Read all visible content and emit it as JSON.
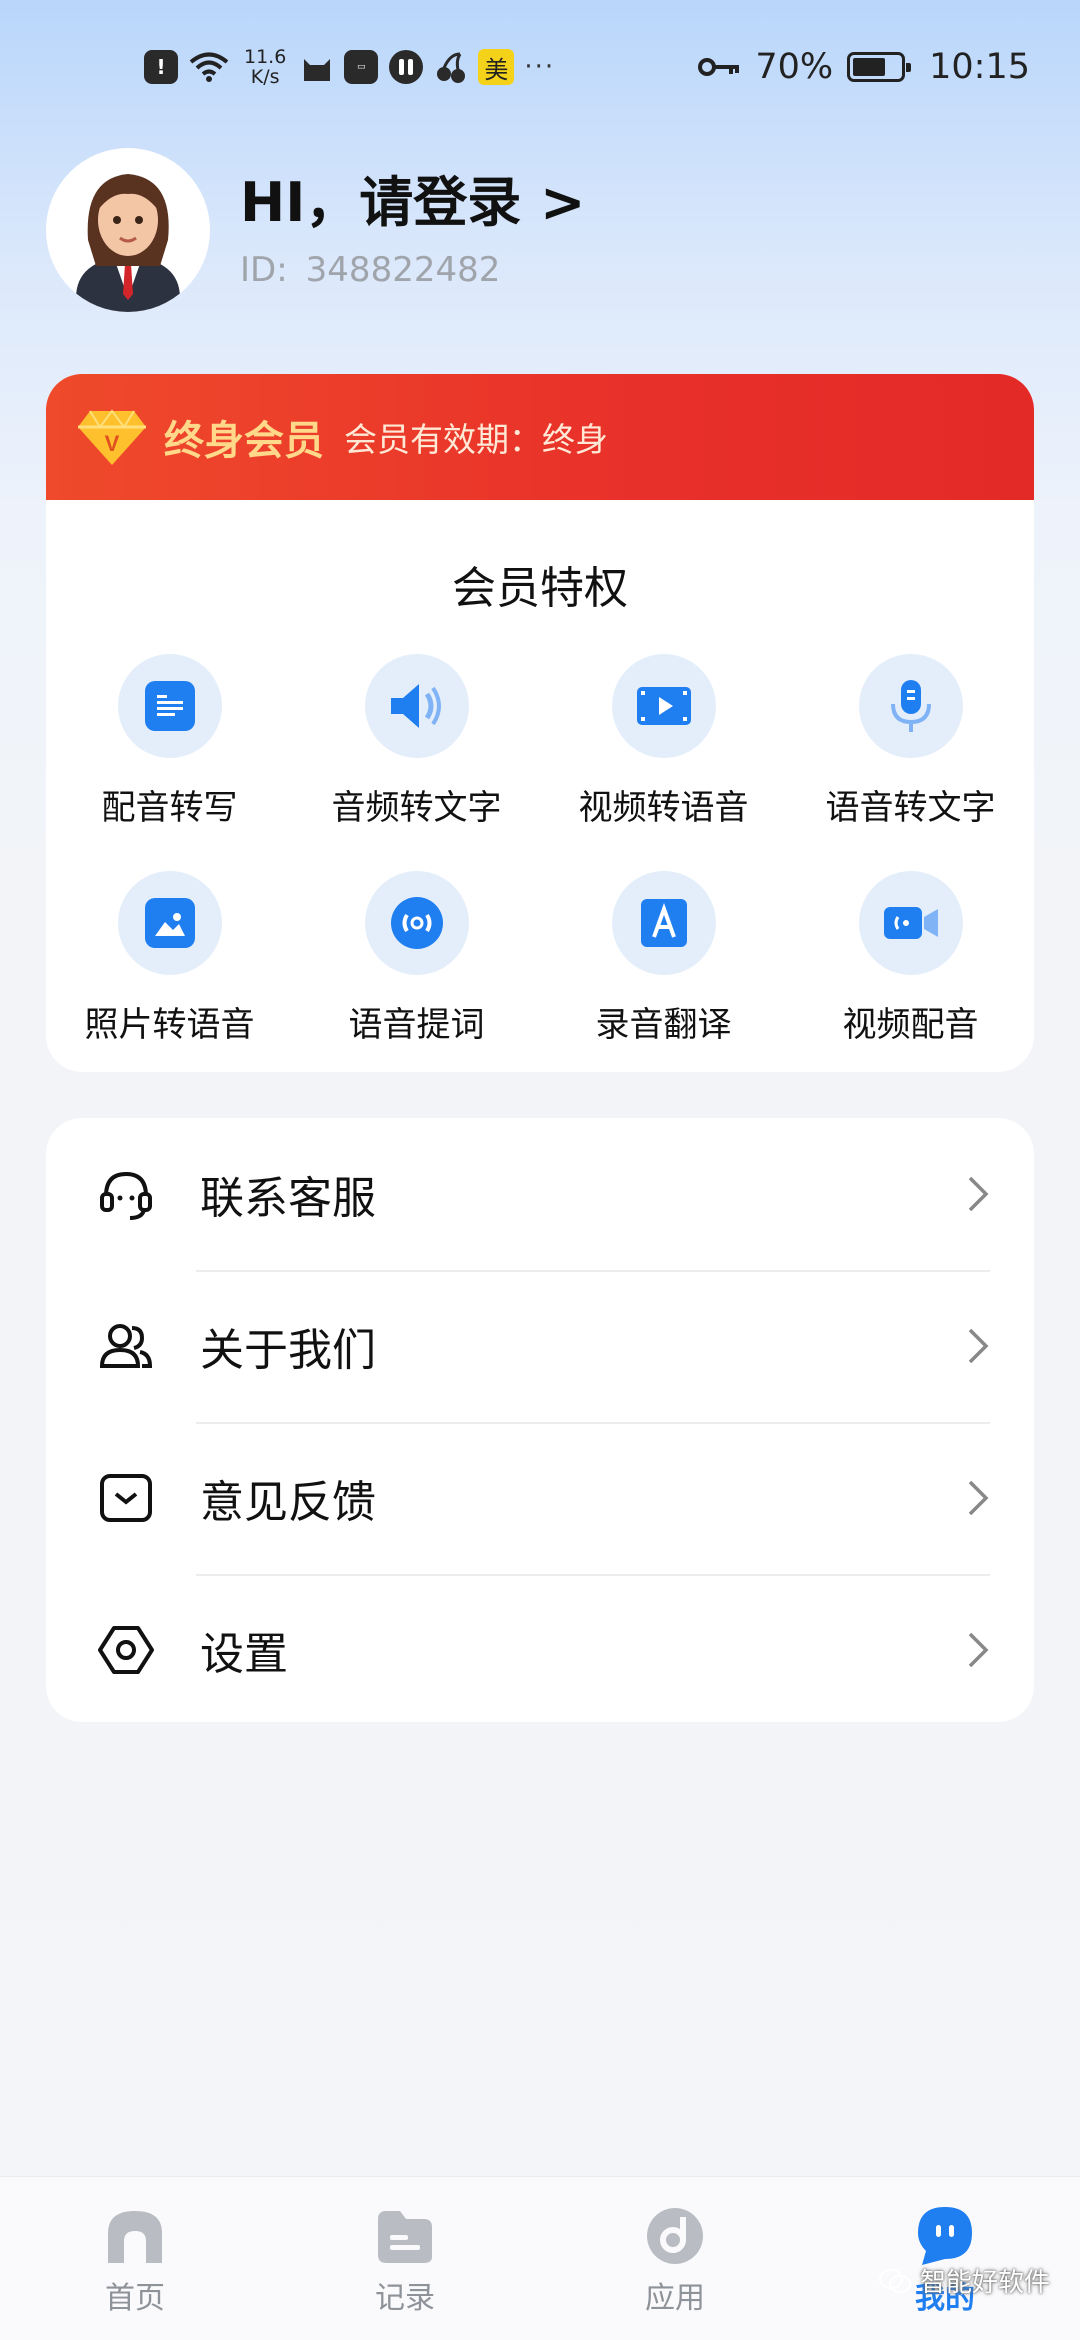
{
  "status_bar": {
    "network_speed_value": "11.6",
    "network_speed_unit": "K/s",
    "meituan_badge": "美",
    "more_dots": "···",
    "battery_percent": "70%",
    "battery_level": 0.7,
    "time": "10:15"
  },
  "profile": {
    "greeting": "HI，请登录 >",
    "id_label": "ID:",
    "id_value": "348822482"
  },
  "membership": {
    "title": "终身会员",
    "expiry": "会员有效期：终身",
    "badge_letter": "V",
    "privileges_title": "会员特权",
    "features": [
      {
        "label": "配音转写",
        "icon": "dubbing-transcribe-icon"
      },
      {
        "label": "音频转文字",
        "icon": "audio-to-text-icon"
      },
      {
        "label": "视频转语音",
        "icon": "video-to-speech-icon"
      },
      {
        "label": "语音转文字",
        "icon": "microphone-icon"
      },
      {
        "label": "照片转语音",
        "icon": "photo-icon"
      },
      {
        "label": "语音提词",
        "icon": "teleprompter-icon"
      },
      {
        "label": "录音翻译",
        "icon": "translate-icon"
      },
      {
        "label": "视频配音",
        "icon": "video-dubbing-icon"
      }
    ]
  },
  "menu": {
    "items": [
      {
        "label": "联系客服",
        "icon": "headset-icon"
      },
      {
        "label": "关于我们",
        "icon": "users-icon"
      },
      {
        "label": "意见反馈",
        "icon": "feedback-icon"
      },
      {
        "label": "设置",
        "icon": "settings-icon"
      }
    ]
  },
  "bottom_nav": {
    "items": [
      {
        "label": "首页",
        "icon": "home-icon"
      },
      {
        "label": "记录",
        "icon": "folder-icon"
      },
      {
        "label": "应用",
        "icon": "apps-icon"
      },
      {
        "label": "我的",
        "icon": "profile-icon",
        "active": true
      }
    ]
  },
  "watermark": "智能好软件",
  "colors": {
    "accent": "#1f7ef0",
    "banner_red": "#e8302a",
    "member_gold": "#ffd88a",
    "icon_bg": "#e4eefb"
  }
}
